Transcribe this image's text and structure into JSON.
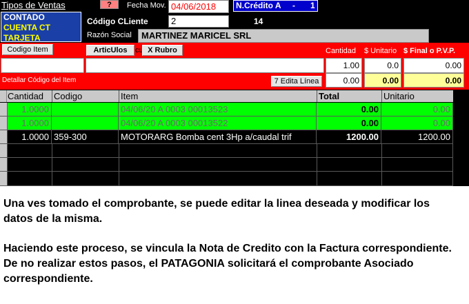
{
  "header": {
    "tipos_label": "Tipos de Ventas",
    "tipos_options": [
      "CONTADO",
      "CUENTA CT",
      "TARJETA"
    ],
    "help_button": "?",
    "fecha_label": "Fecha Mov.",
    "fecha_value": "04/06/2018",
    "doc_label": "N.Crédito  A",
    "doc_separator": "-",
    "doc_number": "1",
    "codigo_cliente_label": "Código CLiente",
    "codigo_cliente_value": "2",
    "codigo_cliente_extra": "14",
    "razon_social_label": "Razón Social",
    "razon_social_value": "MARTINEZ MARICEL SRL"
  },
  "entry": {
    "codigo_item_button": "Codigo Item",
    "articulos_button": "ArticUlos",
    "cu_label": "cu",
    "rubro_button": "X Rubro",
    "cantidad_label": "Cantidad",
    "unitario_label": "$ Unitario",
    "final_label": "$ Final o P.V.P.",
    "cantidad_value": "1.00",
    "unitario_value": "0.0",
    "final_value": "0.00",
    "detallar_label": "Detallar Código del Item",
    "edita_button": "7 Edita Línea",
    "cantidad_value2": "0.00",
    "unitario_value2": "0.00",
    "final_value2": "0.00"
  },
  "grid": {
    "columns": [
      "Cantidad",
      "Codigo",
      "Item",
      "Total",
      "Unitario"
    ],
    "rows": [
      {
        "cantidad": "1.0000",
        "codigo": "",
        "item": "04/06/20 A 0003 00013523",
        "total": "0.00",
        "unitario": "0.00",
        "style": "green"
      },
      {
        "cantidad": "1.0000",
        "codigo": "",
        "item": "04/06/20 A 0003 00013522",
        "total": "0.00",
        "unitario": "0.00",
        "style": "green"
      },
      {
        "cantidad": "1.0000",
        "codigo": "359-300",
        "item": "MOTORARG Bomba cent 3Hp a/caudal trif",
        "total": "1200.00",
        "unitario": "1200.00",
        "style": "black"
      }
    ]
  },
  "description": {
    "para1": "Una ves tomado el comprobante, se puede editar la linea deseada y modificar los datos de la misma.",
    "para2": "Haciendo este proceso, se vincula la Nota de Credito con la Factura correspondiente.  De no realizar estos pasos, el PATAGONIA solicitará el comprobante Asociado correspondiente."
  },
  "colors": {
    "row_green": "#00ff00",
    "row_green_text": "#6b6b6b",
    "red_band": "#ff0000",
    "doc_blue": "#0000cc"
  }
}
